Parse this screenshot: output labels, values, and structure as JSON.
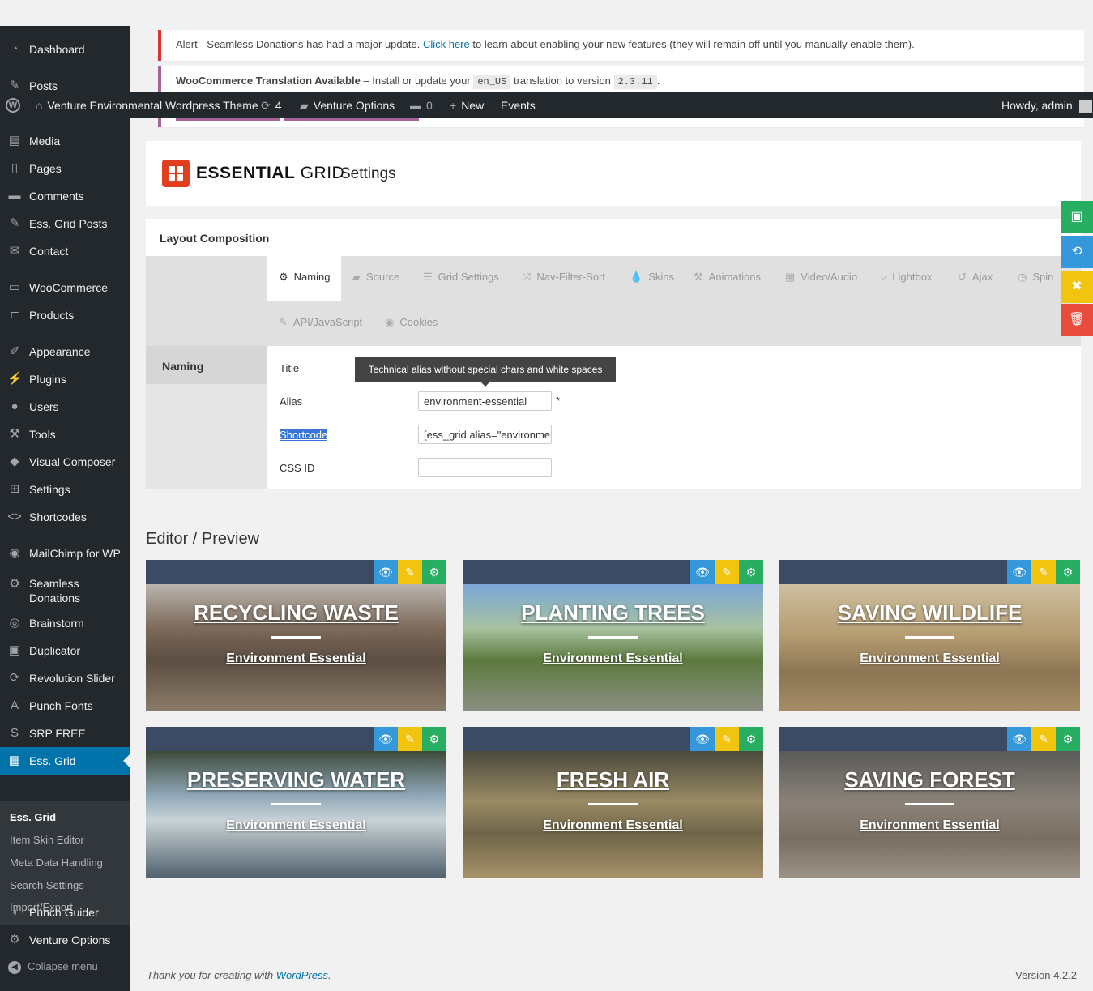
{
  "sidebar": {
    "items": [
      {
        "label": "Dashboard",
        "icon": "dashboard-icon",
        "glyph": "◔"
      },
      {
        "label": "Posts",
        "icon": "pin-icon",
        "glyph": "✎"
      },
      {
        "label": "Media",
        "icon": "media-icon",
        "glyph": "▤"
      },
      {
        "label": "Pages",
        "icon": "pages-icon",
        "glyph": "▯"
      },
      {
        "label": "Comments",
        "icon": "comment-icon",
        "glyph": "▬"
      },
      {
        "label": "Ess. Grid Posts",
        "icon": "pin-icon",
        "glyph": "✎"
      },
      {
        "label": "Contact",
        "icon": "mail-icon",
        "glyph": "✉"
      },
      {
        "label": "WooCommerce",
        "icon": "woo-icon",
        "glyph": "▭"
      },
      {
        "label": "Products",
        "icon": "cart-icon",
        "glyph": "⊏"
      },
      {
        "label": "Appearance",
        "icon": "brush-icon",
        "glyph": "✐"
      },
      {
        "label": "Plugins",
        "icon": "plug-icon",
        "glyph": "⚡"
      },
      {
        "label": "Users",
        "icon": "user-icon",
        "glyph": "●"
      },
      {
        "label": "Tools",
        "icon": "wrench-icon",
        "glyph": "⚒"
      },
      {
        "label": "Visual Composer",
        "icon": "vc-icon",
        "glyph": "◆"
      },
      {
        "label": "Settings",
        "icon": "sliders-icon",
        "glyph": "⊞"
      },
      {
        "label": "Shortcodes",
        "icon": "code-icon",
        "glyph": "<>"
      },
      {
        "label": "MailChimp for WP",
        "icon": "mailchimp-icon",
        "glyph": "◉"
      },
      {
        "label": "Seamless Donations",
        "icon": "gear-icon",
        "glyph": "⚙"
      },
      {
        "label": "Brainstorm",
        "icon": "brain-icon",
        "glyph": "◎"
      },
      {
        "label": "Duplicator",
        "icon": "duplicator-icon",
        "glyph": "▣"
      },
      {
        "label": "Revolution Slider",
        "icon": "refresh-icon",
        "glyph": "⟳"
      },
      {
        "label": "Punch Fonts",
        "icon": "font-icon",
        "glyph": "A"
      },
      {
        "label": "SRP FREE",
        "icon": "srp-icon",
        "glyph": "S"
      },
      {
        "label": "Ess. Grid",
        "icon": "grid-icon",
        "glyph": "▦"
      },
      {
        "label": "Punch Guider",
        "icon": "megaphone-icon",
        "glyph": "◖"
      },
      {
        "label": "Venture Options",
        "icon": "gear-icon",
        "glyph": "⚙"
      }
    ],
    "submenu": [
      "Ess. Grid",
      "Item Skin Editor",
      "Meta Data Handling",
      "Search Settings",
      "Import/Export"
    ],
    "collapse": "Collapse menu"
  },
  "adminbar": {
    "site": "Venture Environmental Wordpress Theme",
    "updates": "4",
    "options": "Venture Options",
    "comments": "0",
    "new": "New",
    "events": "Events",
    "howdy": "Howdy, admin"
  },
  "notices": {
    "alert_pre": "Alert - Seamless Donations has had a major update.",
    "alert_link": "Click here",
    "alert_post": "to learn about enabling your new features (they will remain off until you manually enable them).",
    "woo_title": "WooCommerce Translation Available",
    "woo_mid": "– Install or update your",
    "woo_code1": "en_US",
    "woo_mid2": "translation to version",
    "woo_code2": "2.3.11",
    "woo_end": "."
  },
  "header": {
    "brand_bold": "ESSENTIAL",
    "brand_light": "GRID",
    "settings": "Settings"
  },
  "layout": {
    "title": "Layout Composition",
    "tabs": [
      "Naming",
      "Source",
      "Grid Settings",
      "Nav-Filter-Sort",
      "Skins",
      "Animations",
      "Video/Audio",
      "Lightbox",
      "Ajax",
      "Spin",
      "API/JavaScript",
      "Cookies"
    ],
    "section": "Naming",
    "tooltip": "Technical alias without special chars and white spaces",
    "fields": {
      "title_label": "Title",
      "alias_label": "Alias",
      "alias_value": "environment-essential",
      "required": "*",
      "shortcode_label": "Shortcode",
      "shortcode_value": "[ess_grid alias=\"environment-essential\"]",
      "cssid_label": "CSS ID",
      "cssid_value": ""
    }
  },
  "editor": {
    "title": "Editor / Preview",
    "tiles": [
      {
        "title": "RECYCLING WASTE",
        "subtitle": "Environment Essential"
      },
      {
        "title": "PLANTING TREES",
        "subtitle": "Environment Essential"
      },
      {
        "title": "SAVING WILDLIFE",
        "subtitle": "Environment Essential"
      },
      {
        "title": "PRESERVING WATER",
        "subtitle": "Environment Essential"
      },
      {
        "title": "FRESH AIR",
        "subtitle": "Environment Essential"
      },
      {
        "title": "SAVING FOREST",
        "subtitle": "Environment Essential"
      }
    ]
  },
  "footer": {
    "thanks": "Thank you for creating with",
    "wp": "WordPress",
    "dot": ".",
    "version": "Version 4.2.2"
  },
  "colors": {
    "accent": "#0073aa",
    "green": "#27ae60",
    "blue": "#3498db",
    "yellow": "#f1c40f",
    "red": "#e74c3c",
    "brand": "#e13e20"
  }
}
